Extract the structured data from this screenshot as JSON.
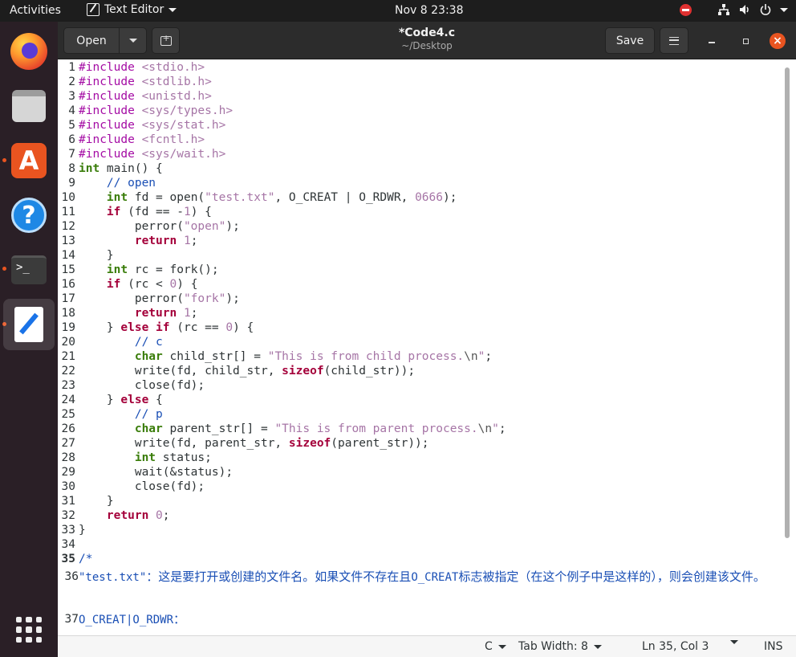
{
  "topbar": {
    "activities": "Activities",
    "app_name": "Text Editor",
    "clock": "Nov 8  23:38",
    "icons": [
      "stop-icon",
      "network-icon",
      "volume-icon",
      "power-icon"
    ]
  },
  "dock": {
    "items": [
      "firefox-icon",
      "files-icon",
      "software-store-icon",
      "help-icon",
      "terminal-icon",
      "text-editor-icon",
      "show-apps-icon"
    ],
    "terminal_glyph": ">_",
    "store_glyph": "A",
    "help_glyph": "?"
  },
  "header": {
    "open_label": "Open",
    "title": "*Code4.c",
    "subtitle": "~/Desktop",
    "save_label": "Save",
    "close_glyph": "×"
  },
  "editor": {
    "lines": [
      {
        "n": "1",
        "t": [
          [
            "pre",
            "#include"
          ],
          [
            "plain",
            " "
          ],
          [
            "inc",
            "<stdio.h>"
          ]
        ]
      },
      {
        "n": "2",
        "t": [
          [
            "pre",
            "#include"
          ],
          [
            "plain",
            " "
          ],
          [
            "inc",
            "<stdlib.h>"
          ]
        ]
      },
      {
        "n": "3",
        "t": [
          [
            "pre",
            "#include"
          ],
          [
            "plain",
            " "
          ],
          [
            "inc",
            "<unistd.h>"
          ]
        ]
      },
      {
        "n": "4",
        "t": [
          [
            "pre",
            "#include"
          ],
          [
            "plain",
            " "
          ],
          [
            "inc",
            "<sys/types.h>"
          ]
        ]
      },
      {
        "n": "5",
        "t": [
          [
            "pre",
            "#include"
          ],
          [
            "plain",
            " "
          ],
          [
            "inc",
            "<sys/stat.h>"
          ]
        ]
      },
      {
        "n": "6",
        "t": [
          [
            "pre",
            "#include"
          ],
          [
            "plain",
            " "
          ],
          [
            "inc",
            "<fcntl.h>"
          ]
        ]
      },
      {
        "n": "7",
        "t": [
          [
            "pre",
            "#include"
          ],
          [
            "plain",
            " "
          ],
          [
            "inc",
            "<sys/wait.h>"
          ]
        ]
      },
      {
        "n": "8",
        "t": [
          [
            "type",
            "int"
          ],
          [
            "plain",
            " main() {"
          ]
        ]
      },
      {
        "n": "9",
        "t": [
          [
            "plain",
            "    "
          ],
          [
            "com",
            "// open"
          ]
        ]
      },
      {
        "n": "10",
        "t": [
          [
            "plain",
            "    "
          ],
          [
            "type",
            "int"
          ],
          [
            "plain",
            " fd = open("
          ],
          [
            "str",
            "\"test.txt\""
          ],
          [
            "plain",
            ", O_CREAT | O_RDWR, "
          ],
          [
            "num",
            "0666"
          ],
          [
            "plain",
            ");"
          ]
        ]
      },
      {
        "n": "11",
        "t": [
          [
            "plain",
            "    "
          ],
          [
            "kw",
            "if"
          ],
          [
            "plain",
            " (fd == -"
          ],
          [
            "num",
            "1"
          ],
          [
            "plain",
            ") {"
          ]
        ]
      },
      {
        "n": "12",
        "t": [
          [
            "plain",
            "        perror("
          ],
          [
            "str",
            "\"open\""
          ],
          [
            "plain",
            ");"
          ]
        ]
      },
      {
        "n": "13",
        "t": [
          [
            "plain",
            "        "
          ],
          [
            "kw",
            "return"
          ],
          [
            "plain",
            " "
          ],
          [
            "num",
            "1"
          ],
          [
            "plain",
            ";"
          ]
        ]
      },
      {
        "n": "14",
        "t": [
          [
            "plain",
            "    }"
          ]
        ]
      },
      {
        "n": "15",
        "t": [
          [
            "plain",
            "    "
          ],
          [
            "type",
            "int"
          ],
          [
            "plain",
            " rc = fork();"
          ]
        ]
      },
      {
        "n": "16",
        "t": [
          [
            "plain",
            "    "
          ],
          [
            "kw",
            "if"
          ],
          [
            "plain",
            " (rc < "
          ],
          [
            "num",
            "0"
          ],
          [
            "plain",
            ") {"
          ]
        ]
      },
      {
        "n": "17",
        "t": [
          [
            "plain",
            "        perror("
          ],
          [
            "str",
            "\"fork\""
          ],
          [
            "plain",
            ");"
          ]
        ]
      },
      {
        "n": "18",
        "t": [
          [
            "plain",
            "        "
          ],
          [
            "kw",
            "return"
          ],
          [
            "plain",
            " "
          ],
          [
            "num",
            "1"
          ],
          [
            "plain",
            ";"
          ]
        ]
      },
      {
        "n": "19",
        "t": [
          [
            "plain",
            "    } "
          ],
          [
            "kw",
            "else if"
          ],
          [
            "plain",
            " (rc == "
          ],
          [
            "num",
            "0"
          ],
          [
            "plain",
            ") {"
          ]
        ]
      },
      {
        "n": "20",
        "t": [
          [
            "plain",
            "        "
          ],
          [
            "com",
            "// c"
          ]
        ]
      },
      {
        "n": "21",
        "t": [
          [
            "plain",
            "        "
          ],
          [
            "type",
            "char"
          ],
          [
            "plain",
            " child_str[] = "
          ],
          [
            "str",
            "\"This is from child process."
          ],
          [
            "esc",
            "\\n"
          ],
          [
            "str",
            "\""
          ],
          [
            "plain",
            ";"
          ]
        ]
      },
      {
        "n": "22",
        "t": [
          [
            "plain",
            "        write(fd, child_str, "
          ],
          [
            "kw",
            "sizeof"
          ],
          [
            "plain",
            "(child_str));"
          ]
        ]
      },
      {
        "n": "23",
        "t": [
          [
            "plain",
            "        close(fd);"
          ]
        ]
      },
      {
        "n": "24",
        "t": [
          [
            "plain",
            "    } "
          ],
          [
            "kw",
            "else"
          ],
          [
            "plain",
            " {"
          ]
        ]
      },
      {
        "n": "25",
        "t": [
          [
            "plain",
            "        "
          ],
          [
            "com",
            "// p"
          ]
        ]
      },
      {
        "n": "26",
        "t": [
          [
            "plain",
            "        "
          ],
          [
            "type",
            "char"
          ],
          [
            "plain",
            " parent_str[] = "
          ],
          [
            "str",
            "\"This is from parent process."
          ],
          [
            "esc",
            "\\n"
          ],
          [
            "str",
            "\""
          ],
          [
            "plain",
            ";"
          ]
        ]
      },
      {
        "n": "27",
        "t": [
          [
            "plain",
            "        write(fd, parent_str, "
          ],
          [
            "kw",
            "sizeof"
          ],
          [
            "plain",
            "(parent_str));"
          ]
        ]
      },
      {
        "n": "28",
        "t": [
          [
            "plain",
            "        "
          ],
          [
            "type",
            "int"
          ],
          [
            "plain",
            " status;"
          ]
        ]
      },
      {
        "n": "29",
        "t": [
          [
            "plain",
            "        wait(&status);"
          ]
        ]
      },
      {
        "n": "30",
        "t": [
          [
            "plain",
            "        close(fd);"
          ]
        ]
      },
      {
        "n": "31",
        "t": [
          [
            "plain",
            "    }"
          ]
        ]
      },
      {
        "n": "32",
        "t": [
          [
            "plain",
            "    "
          ],
          [
            "kw",
            "return"
          ],
          [
            "plain",
            " "
          ],
          [
            "num",
            "0"
          ],
          [
            "plain",
            ";"
          ]
        ]
      },
      {
        "n": "33",
        "t": [
          [
            "plain",
            "}"
          ]
        ]
      },
      {
        "n": "34",
        "t": []
      },
      {
        "n": "35",
        "t": [
          [
            "com",
            "/*"
          ]
        ],
        "current": true
      }
    ],
    "line36_num": "36",
    "line36_a": "\"test.txt\"",
    "line36_b": "：这是要打开或创建的文件名。如果文件不存在且",
    "line36_c": "O_CREAT",
    "line36_d": "标志被指定（在这个例子中是这样的），则会创建该文件。",
    "line37_num": "37",
    "line37_a": "O_CREAT|O_RDWR",
    "line37_b": "："
  },
  "statusbar": {
    "language": "C",
    "tab_width": "Tab Width: 8",
    "position": "Ln 35, Col 3",
    "mode": "INS"
  }
}
